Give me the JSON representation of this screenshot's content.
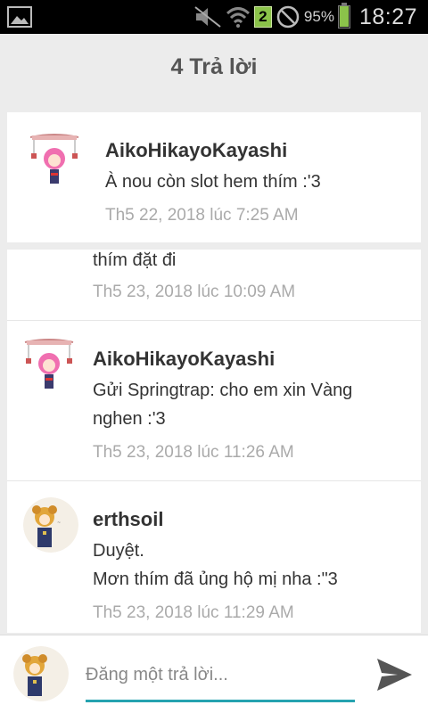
{
  "status_bar": {
    "notification_count": "2",
    "battery_percent": "95%",
    "battery_level": 0.95,
    "time": "18:27",
    "icons": [
      "gallery-icon",
      "mute-icon",
      "wifi-icon",
      "notification-badge",
      "no-signal-icon",
      "battery-icon"
    ]
  },
  "header": {
    "title": "4 Trả lời"
  },
  "comments": [
    {
      "author": "AikoHikayoKayashi",
      "text": "À nou còn slot hem thím :'3",
      "time": "Th5 22, 2018 lúc 7:25 AM"
    },
    {
      "author": "",
      "text": "thím đặt đi",
      "time": "Th5 23, 2018 lúc 10:09 AM"
    },
    {
      "author": "AikoHikayoKayashi",
      "text_lines": [
        "Gửi Springtrap: cho em xin Vàng",
        "nghen :'3"
      ],
      "time": "Th5 23, 2018 lúc 11:26 AM"
    },
    {
      "author": "erthsoil",
      "text_lines": [
        "Duyệt.",
        "Mơn thím đã ủng hộ mị nha :\"3"
      ],
      "time": "Th5 23, 2018 lúc 11:29 AM"
    }
  ],
  "composer": {
    "placeholder": "Đăng một trả lời..."
  },
  "colors": {
    "accent": "#26a3b0",
    "battery": "#8bc34a",
    "background": "#ececec"
  }
}
